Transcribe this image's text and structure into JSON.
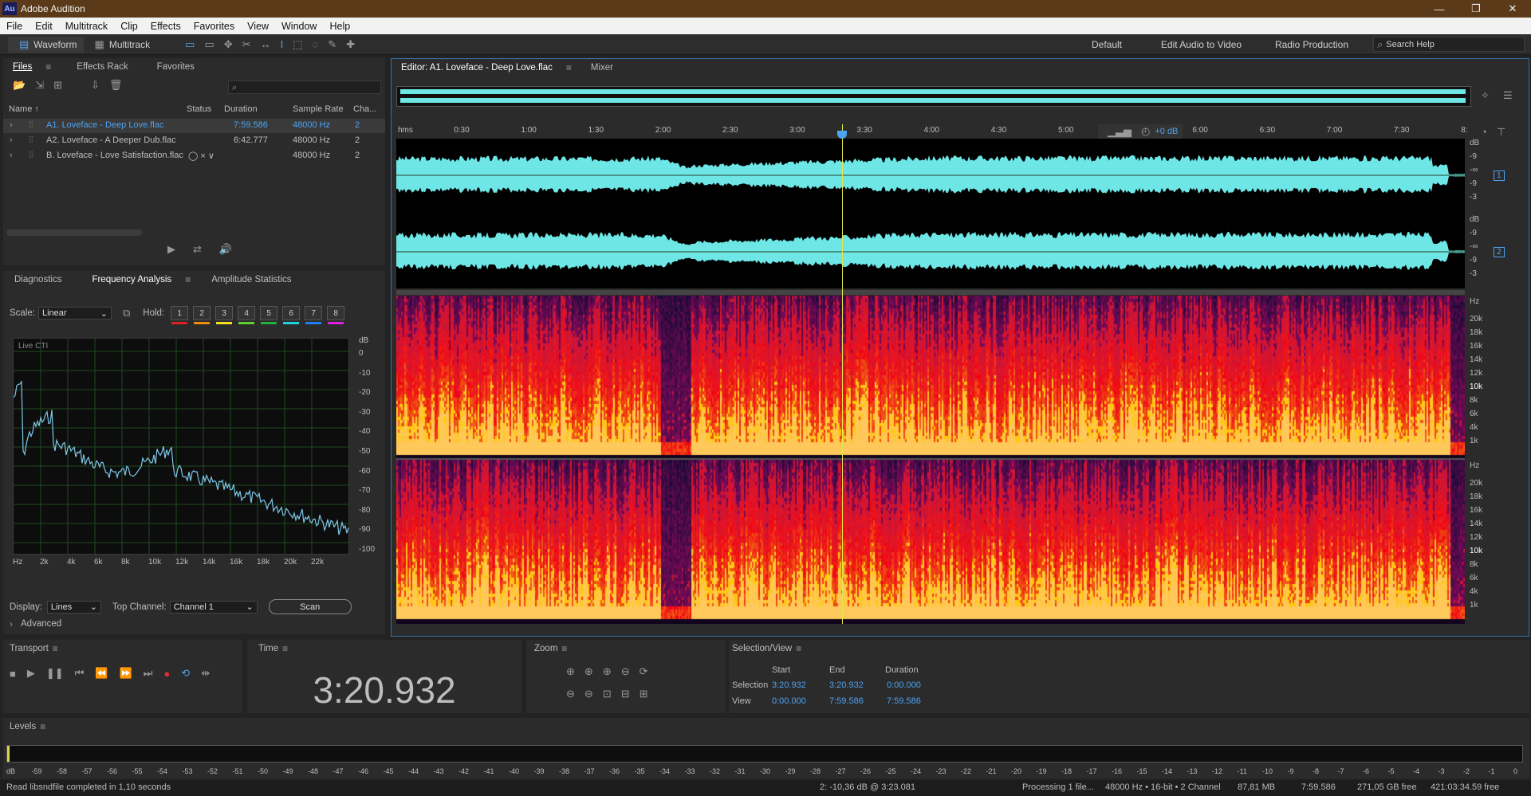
{
  "app": {
    "title": "Adobe Audition",
    "logo": "Au"
  },
  "window_controls": [
    "minimize-icon",
    "restore-icon",
    "close-icon"
  ],
  "menu": [
    "File",
    "Edit",
    "Multitrack",
    "Clip",
    "Effects",
    "Favorites",
    "View",
    "Window",
    "Help"
  ],
  "toolbar": {
    "waveform": "Waveform",
    "multitrack": "Multitrack",
    "workspaces": [
      "Default",
      "Edit Audio to Video",
      "Radio Production"
    ],
    "more": "»",
    "search_placeholder": "Search Help"
  },
  "files_panel": {
    "tabs": [
      "Files",
      "Effects Rack",
      "Favorites"
    ],
    "columns": [
      "Name ↑",
      "Status",
      "Duration",
      "Sample Rate",
      "Cha..."
    ],
    "rows": [
      {
        "name": "A1. Loveface - Deep Love.flac",
        "status": "",
        "duration": "7:59.586",
        "rate": "48000 Hz",
        "ch": "2",
        "selected": true
      },
      {
        "name": "A2. Loveface - A Deeper Dub.flac",
        "status": "",
        "duration": "6:42.777",
        "rate": "48000 Hz",
        "ch": "2",
        "selected": false
      },
      {
        "name": "B. Loveface - Love Satisfaction.flac",
        "status": "◯ × ∨",
        "duration": "",
        "rate": "48000 Hz",
        "ch": "2",
        "selected": false
      }
    ],
    "search_icon": "search-icon"
  },
  "freq_panel": {
    "tabs": [
      "Diagnostics",
      "Frequency Analysis",
      "Amplitude Statistics"
    ],
    "scale_label": "Scale:",
    "scale_value": "Linear",
    "hold_label": "Hold:",
    "hold": [
      {
        "n": "1",
        "c": "#e02020"
      },
      {
        "n": "2",
        "c": "#f08a10"
      },
      {
        "n": "3",
        "c": "#f0e020"
      },
      {
        "n": "4",
        "c": "#60d030"
      },
      {
        "n": "5",
        "c": "#20b040"
      },
      {
        "n": "6",
        "c": "#20d0e0"
      },
      {
        "n": "7",
        "c": "#2080f0"
      },
      {
        "n": "8",
        "c": "#e020e0"
      }
    ],
    "live": "Live CTI",
    "db_ticks": [
      "dB",
      "0",
      "-10",
      "-20",
      "-30",
      "-40",
      "-50",
      "-60",
      "-70",
      "-80",
      "-90",
      "-100"
    ],
    "hz_ticks": [
      "Hz",
      "2k",
      "4k",
      "6k",
      "8k",
      "10k",
      "12k",
      "14k",
      "16k",
      "18k",
      "20k",
      "22k"
    ],
    "display_label": "Display:",
    "display_value": "Lines",
    "top_channel_label": "Top Channel:",
    "top_channel_value": "Channel 1",
    "scan": "Scan",
    "advanced": "Advanced"
  },
  "editor": {
    "tabs": [
      "Editor: A1. Loveface - Deep Love.flac",
      "Mixer"
    ],
    "ruler": [
      "hms",
      "0:30",
      "1:00",
      "1:30",
      "2:00",
      "2:30",
      "3:00",
      "3:30",
      "4:00",
      "4:30",
      "5:00",
      "5:30",
      "6:00",
      "6:30",
      "7:00",
      "7:30",
      "8:"
    ],
    "hud_gain": "+0 dB",
    "amp_scale": [
      "dB",
      "-9",
      "-∞",
      "-9",
      "-3"
    ],
    "channels": [
      "1",
      "2"
    ],
    "freq_scale": [
      "Hz",
      "20k",
      "18k",
      "16k",
      "14k",
      "12k",
      "10k",
      "8k",
      "6k",
      "4k",
      "1k"
    ],
    "waveform_color": "#6ee6e6",
    "playhead_color": "#e6e64a"
  },
  "transport": {
    "title": "Transport",
    "buttons": [
      "stop-icon",
      "play-icon",
      "pause-icon",
      "go-start-icon",
      "rewind-icon",
      "fast-forward-icon",
      "go-end-icon",
      "record-icon",
      "loop-icon",
      "skip-selection-icon"
    ]
  },
  "time": {
    "title": "Time",
    "value": "3:20.932"
  },
  "zoom": {
    "title": "Zoom"
  },
  "selection": {
    "title": "Selection/View",
    "headers": [
      "Start",
      "End",
      "Duration"
    ],
    "rows": [
      {
        "label": "Selection",
        "start": "3:20.932",
        "end": "3:20.932",
        "duration": "0:00.000"
      },
      {
        "label": "View",
        "start": "0:00.000",
        "end": "7:59.586",
        "duration": "7:59.586"
      }
    ]
  },
  "levels": {
    "title": "Levels",
    "ticks": [
      "dB",
      "-59",
      "-58",
      "-57",
      "-56",
      "-55",
      "-54",
      "-53",
      "-52",
      "-51",
      "-50",
      "-49",
      "-48",
      "-47",
      "-46",
      "-45",
      "-44",
      "-43",
      "-42",
      "-41",
      "-40",
      "-39",
      "-38",
      "-37",
      "-36",
      "-35",
      "-34",
      "-33",
      "-32",
      "-31",
      "-30",
      "-29",
      "-28",
      "-27",
      "-26",
      "-25",
      "-24",
      "-23",
      "-22",
      "-21",
      "-20",
      "-19",
      "-18",
      "-17",
      "-16",
      "-15",
      "-14",
      "-13",
      "-12",
      "-11",
      "-10",
      "-9",
      "-8",
      "-7",
      "-6",
      "-5",
      "-4",
      "-3",
      "-2",
      "-1",
      "0"
    ]
  },
  "status": {
    "left": "Read libsndfile completed in 1,10 seconds",
    "cursor": "2: -10,36 dB @ 3:23.081",
    "processing": "Processing 1 file...",
    "format": "48000 Hz • 16-bit • 2 Channel",
    "size": "87,81 MB",
    "duration": "7:59.586",
    "free": "271,05 GB free",
    "free_time": "421:03:34.59 free"
  }
}
